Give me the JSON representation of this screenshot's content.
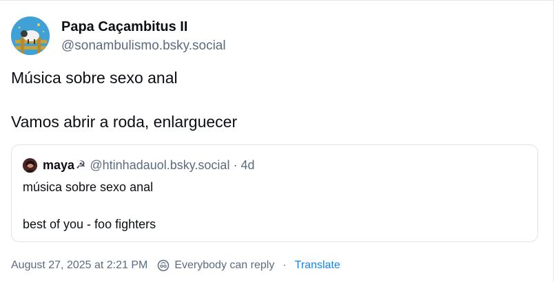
{
  "post": {
    "author": {
      "display_name": "Papa Caçambitus II",
      "handle": "@sonambulismo.bsky.social"
    },
    "text_lines": [
      "Música sobre sexo anal",
      "Vamos abrir a roda, enlarguecer"
    ]
  },
  "quote": {
    "author_name": "maya",
    "name_emoji": "☭",
    "handle": "@htinhadauol.bsky.social",
    "separator": "·",
    "time": "4d",
    "text_lines": [
      "música sobre sexo anal",
      "best of you - foo fighters"
    ]
  },
  "meta": {
    "timestamp": "August 27, 2025 at 2:21 PM",
    "reply_setting": "Everybody can reply",
    "separator": "·",
    "translate_label": "Translate"
  },
  "colors": {
    "text": "#0b0f14",
    "muted": "#5b6b7e",
    "link": "#1083fe",
    "border": "#dfe3e8"
  },
  "icons": {
    "avatar": "sheep-on-fence-avatar",
    "reply_setting": "reply-permission-icon"
  }
}
